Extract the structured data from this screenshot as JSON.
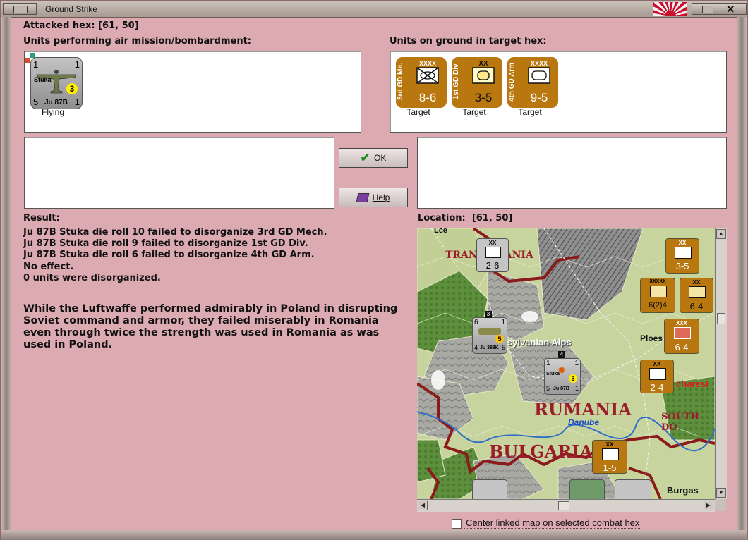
{
  "window": {
    "title": "Ground Strike"
  },
  "attacked_hex": {
    "label": "Attacked hex:",
    "value": "[61, 50]"
  },
  "air_units": {
    "label": "Units performing air mission/bombardment:",
    "items": [
      {
        "name": "Stuka",
        "type": "Ju 87B",
        "top_left": "1",
        "top_right": "1",
        "bottom_left": "5",
        "bottom_right": "1",
        "badge": "3",
        "status": "Flying"
      }
    ]
  },
  "ground_units": {
    "label": "Units on ground in target hex:",
    "items": [
      {
        "name": "3rd GD Me.",
        "size": "XXXX",
        "strength": "8-6",
        "status": "Target",
        "symbol": "mech"
      },
      {
        "name": "1st GD Div",
        "size": "XX",
        "strength": "3-5",
        "status": "Target",
        "symbol": "infantry-oval"
      },
      {
        "name": "4th GD Arm",
        "size": "XXXX",
        "strength": "9-5",
        "status": "Target",
        "symbol": "armor-oval"
      }
    ]
  },
  "buttons": {
    "ok": "OK",
    "help": "Help"
  },
  "result": {
    "label": "Result:",
    "lines": [
      "Ju 87B Stuka die roll 10 failed to disorganize 3rd GD Mech.",
      "Ju 87B Stuka die roll 9 failed to disorganize 1st GD Div.",
      "Ju 87B Stuka die roll 6 failed to disorganize 4th GD Arm.",
      "No effect.",
      "0 units were disorganized."
    ],
    "narrative": "While the Luftwaffe performed admirably in Poland in disrupting Soviet command and armor, they failed miserably in Romania even through twice the strength was used in Romania as was used in Poland."
  },
  "location": {
    "label": "Location:",
    "value": "[61, 50]"
  },
  "map_labels": {
    "transylvania": "TRANSYLVANIA",
    "alps": "sylvanian Alps",
    "rumania": "RUMANIA",
    "bulgaria": "BULGARIA",
    "danube": "Danube",
    "south_do": "SOUTH DO",
    "ploesti": "Ploes",
    "bucharest": "charest",
    "burgas": "Burgas",
    "lvov": "Lce"
  },
  "map_counters": [
    {
      "strength": "2-6",
      "size": "XX"
    },
    {
      "strength": "3-5",
      "size": "XX"
    },
    {
      "strength": "6(2)4",
      "size": "XXXXX"
    },
    {
      "strength": "6-4",
      "size": "XX"
    },
    {
      "strength": "6-4",
      "size": "XXX"
    },
    {
      "strength": "2-4",
      "size": "XX"
    },
    {
      "strength": "1-5",
      "size": "XX"
    }
  ],
  "map_air_counters": [
    {
      "type": "Ju 388K",
      "left": "6",
      "right": "1",
      "bottom_left": "4",
      "bottom_right": "5",
      "badge": "5",
      "stack": "3"
    },
    {
      "type": "Ju 87B",
      "name": "Stuka",
      "left": "1",
      "right": "1",
      "bottom_left": "5",
      "bottom_right": "1",
      "badge": "3",
      "stack": "4"
    }
  ],
  "option": {
    "label": "Center linked map on selected combat hex",
    "checked": false
  },
  "colors": {
    "background": "#dcaab1",
    "counter_orange": "#b8770f",
    "map_hex_border": "#8b1a1a"
  }
}
